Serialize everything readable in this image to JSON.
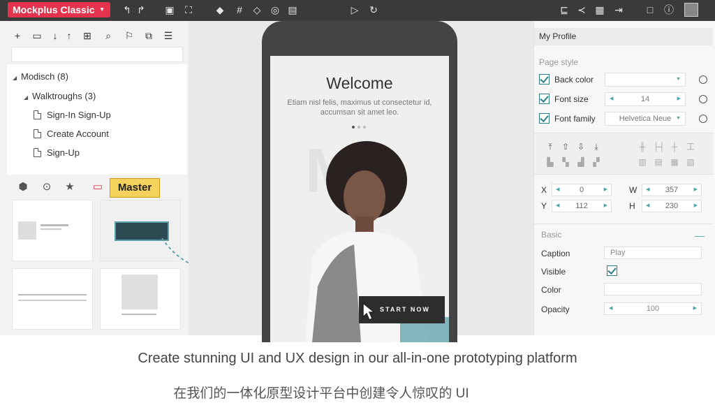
{
  "toolbar": {
    "brand": "Mockplus Classic"
  },
  "left_panel": {
    "tree": [
      {
        "label": "Modisch",
        "count": "(8)"
      },
      {
        "label": "Walktroughs",
        "count": "(3)"
      },
      {
        "label": "Sign-In Sign-Up"
      },
      {
        "label": "Create Account"
      },
      {
        "label": "Sign-Up"
      }
    ],
    "master_tab": "Master",
    "connector_label": "START NOW"
  },
  "canvas": {
    "welcome": "Welcome",
    "subtitle": "Etiam nisl felis, maximus ut consectetur id, accumsan sit amet leo.",
    "start_button": "START NOW",
    "accent": "#5ea0aa"
  },
  "right_panel": {
    "title": "My Profile",
    "page_style": "Page style",
    "back_color": "Back color",
    "font_size": "Font size",
    "font_size_value": "14",
    "font_family": "Font family",
    "font_family_value": "Helvetica Neue",
    "x_label": "X",
    "x_value": "0",
    "y_label": "Y",
    "y_value": "112",
    "w_label": "W",
    "w_value": "357",
    "h_label": "H",
    "h_value": "230",
    "basic": "Basic",
    "caption": "Caption",
    "caption_value": "Play",
    "visible": "Visible",
    "color": "Color",
    "opacity": "Opacity",
    "opacity_value": "100"
  },
  "subtitles": {
    "en": "Create stunning UI and UX design in our all-in-one prototyping platform",
    "zh": "在我们的一体化原型设计平台中创建令人惊叹的 UI"
  },
  "colors": {
    "brand": "#e4344d",
    "toolbar_bg": "#3a3a3a",
    "master_highlight": "#f5d25b",
    "checkbox": "#2f7f8a"
  }
}
